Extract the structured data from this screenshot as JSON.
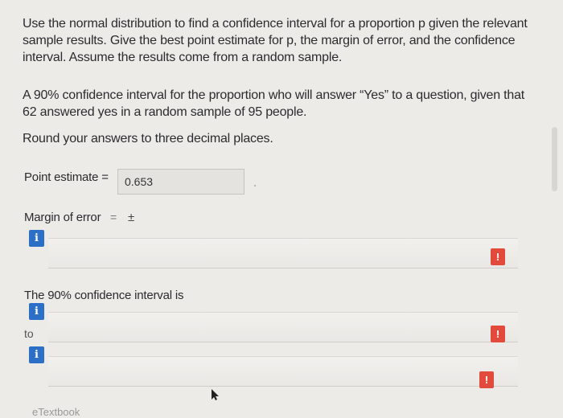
{
  "question": {
    "intro": "Use the normal distribution to find a confidence interval for a proportion p given the relevant sample results. Give the best point estimate for p, the margin of error, and the confidence interval. Assume the results come from a random sample.",
    "scenario": "A 90% confidence interval for the proportion who will answer “Yes” to a question, given that 62 answered yes in a random sample of 95 people.",
    "rounding": "Round your answers to three decimal places."
  },
  "point_estimate": {
    "label": "Point estimate =",
    "value": "0.653"
  },
  "margin_of_error": {
    "label": "Margin of error",
    "equals": "=",
    "pm": "±",
    "value": ""
  },
  "confidence_interval": {
    "label": "The 90% confidence interval is",
    "to_label": "to",
    "lower": "",
    "upper": ""
  },
  "icons": {
    "info": "i",
    "alert": "!"
  },
  "footer_cut_text": "eTextbook"
}
